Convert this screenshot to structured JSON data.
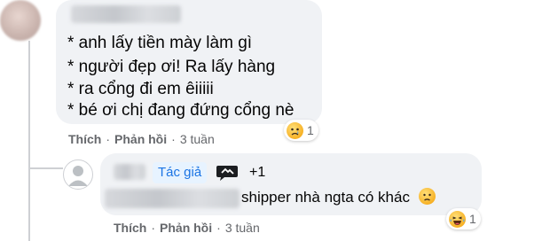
{
  "comment": {
    "lines": [
      "* anh lấy tiền mày làm gì",
      "* người đẹp ơi! Ra lấy hàng",
      "* ra cổng đi em êiiiii",
      "* bé ơi chị đang đứng cổng nè"
    ],
    "actions": {
      "like": "Thích",
      "reply": "Phản hồi",
      "time": "3 tuần",
      "dot": "·"
    },
    "reaction": {
      "icon": "sad-emoji",
      "count": "1"
    }
  },
  "reply": {
    "author_badge": "Tác giả",
    "badge_icon": "chat-badge-icon",
    "badge_count": "+1",
    "text": "shipper nhà ngta có khác",
    "inline_emoji": "sad-face-emoji",
    "actions": {
      "like": "Thích",
      "reply": "Phản hồi",
      "time": "3 tuần",
      "dot": "·"
    },
    "reaction": {
      "icon": "laughing-emoji",
      "count": "1"
    }
  },
  "colors": {
    "bubble": "#f0f2f5",
    "meta_text": "#65676b",
    "author_badge_bg": "#e7f3ff",
    "author_badge_text": "#1b74e4",
    "emoji_yellow": "#f7b125"
  }
}
